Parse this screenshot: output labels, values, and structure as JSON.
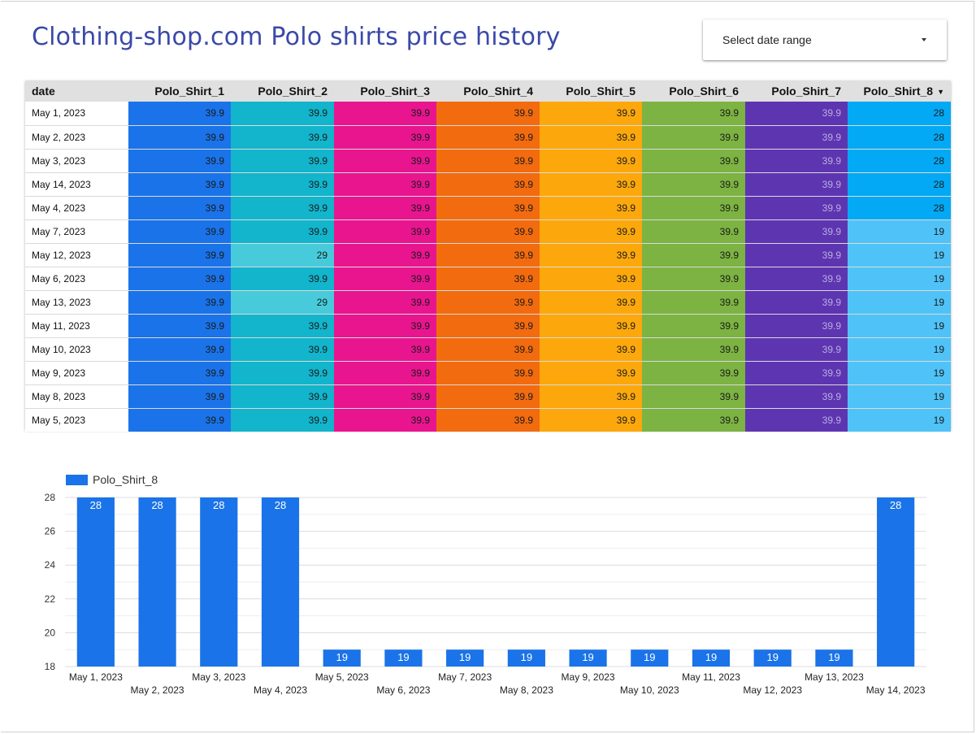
{
  "report": {
    "title": "Clothing-shop.com Polo shirts price history"
  },
  "date_control": {
    "label": "Select date range",
    "icon": "dropdown-caret-icon"
  },
  "table": {
    "columns": [
      "date",
      "Polo_Shirt_1",
      "Polo_Shirt_2",
      "Polo_Shirt_3",
      "Polo_Shirt_4",
      "Polo_Shirt_5",
      "Polo_Shirt_6",
      "Polo_Shirt_7",
      "Polo_Shirt_8"
    ],
    "sort_icon": "sort-descending-icon",
    "sorted_column": "Polo_Shirt_8",
    "column_colors": [
      "#ffffff",
      "#1a73e8",
      "#12b5cb",
      "#e8158f",
      "#f26b0f",
      "#fca80c",
      "#7cb342",
      "#5e35b1",
      "#03a9f4"
    ],
    "light_colors": {
      "Polo_Shirt_2": "#47cbdb",
      "Polo_Shirt_8": "#4fc3f7"
    },
    "rows": [
      [
        "May 1, 2023",
        "39.9",
        "39.9",
        "39.9",
        "39.9",
        "39.9",
        "39.9",
        "39.9",
        "28"
      ],
      [
        "May 2, 2023",
        "39.9",
        "39.9",
        "39.9",
        "39.9",
        "39.9",
        "39.9",
        "39.9",
        "28"
      ],
      [
        "May 3, 2023",
        "39.9",
        "39.9",
        "39.9",
        "39.9",
        "39.9",
        "39.9",
        "39.9",
        "28"
      ],
      [
        "May 14, 2023",
        "39.9",
        "39.9",
        "39.9",
        "39.9",
        "39.9",
        "39.9",
        "39.9",
        "28"
      ],
      [
        "May 4, 2023",
        "39.9",
        "39.9",
        "39.9",
        "39.9",
        "39.9",
        "39.9",
        "39.9",
        "28"
      ],
      [
        "May 7, 2023",
        "39.9",
        "39.9",
        "39.9",
        "39.9",
        "39.9",
        "39.9",
        "39.9",
        "19"
      ],
      [
        "May 12, 2023",
        "39.9",
        "29",
        "39.9",
        "39.9",
        "39.9",
        "39.9",
        "39.9",
        "19"
      ],
      [
        "May 6, 2023",
        "39.9",
        "39.9",
        "39.9",
        "39.9",
        "39.9",
        "39.9",
        "39.9",
        "19"
      ],
      [
        "May 13, 2023",
        "39.9",
        "29",
        "39.9",
        "39.9",
        "39.9",
        "39.9",
        "39.9",
        "19"
      ],
      [
        "May 11, 2023",
        "39.9",
        "39.9",
        "39.9",
        "39.9",
        "39.9",
        "39.9",
        "39.9",
        "19"
      ],
      [
        "May 10, 2023",
        "39.9",
        "39.9",
        "39.9",
        "39.9",
        "39.9",
        "39.9",
        "39.9",
        "19"
      ],
      [
        "May 9, 2023",
        "39.9",
        "39.9",
        "39.9",
        "39.9",
        "39.9",
        "39.9",
        "39.9",
        "19"
      ],
      [
        "May 8, 2023",
        "39.9",
        "39.9",
        "39.9",
        "39.9",
        "39.9",
        "39.9",
        "39.9",
        "19"
      ],
      [
        "May 5, 2023",
        "39.9",
        "39.9",
        "39.9",
        "39.9",
        "39.9",
        "39.9",
        "39.9",
        "19"
      ]
    ]
  },
  "chart_data": {
    "type": "bar",
    "categories": [
      "May 1, 2023",
      "May 2, 2023",
      "May 3, 2023",
      "May 4, 2023",
      "May 5, 2023",
      "May 6, 2023",
      "May 7, 2023",
      "May 8, 2023",
      "May 9, 2023",
      "May 10, 2023",
      "May 11, 2023",
      "May 12, 2023",
      "May 13, 2023",
      "May 14, 2023"
    ],
    "series": [
      {
        "name": "Polo_Shirt_8",
        "color": "#1a73e8",
        "values": [
          28,
          28,
          28,
          28,
          19,
          19,
          19,
          19,
          19,
          19,
          19,
          19,
          19,
          28
        ]
      }
    ],
    "ylim": [
      18,
      28
    ],
    "yticks": [
      18,
      20,
      22,
      24,
      26,
      28
    ],
    "grid": true,
    "legend": "top-left",
    "data_labels": true
  }
}
